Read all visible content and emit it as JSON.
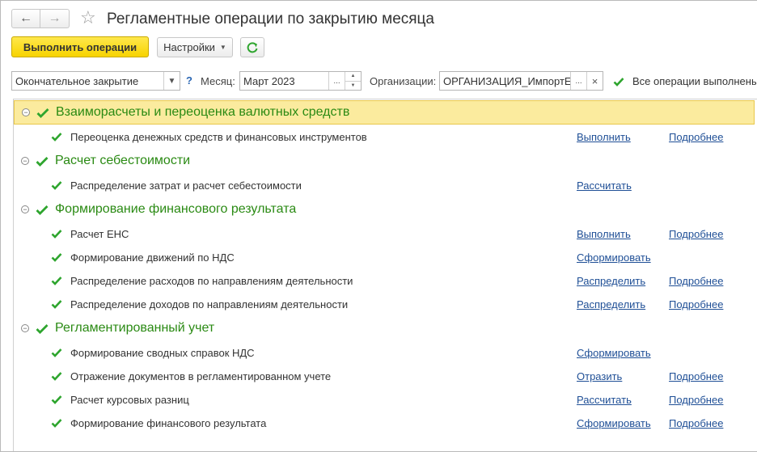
{
  "header": {
    "title": "Регламентные операции по закрытию месяца"
  },
  "toolbar": {
    "run_label": "Выполнить операции",
    "settings_label": "Настройки"
  },
  "filters": {
    "close_type": "Окончательное закрытие",
    "help_mark": "?",
    "month_label": "Месяц:",
    "month_value": "Март 2023",
    "month_select": "...",
    "org_label": "Организации:",
    "org_value": "ОРГАНИЗАЦИЯ_ИмпортЕ",
    "org_select": "...",
    "org_clear": "×",
    "status_text": "Все операции выполнены"
  },
  "groups": [
    {
      "title": "Взаиморасчеты и переоценка валютных средств",
      "items": [
        {
          "title": "Переоценка денежных средств и финансовых инструментов",
          "action": "Выполнить",
          "more": "Подробнее"
        }
      ]
    },
    {
      "title": "Расчет себестоимости",
      "items": [
        {
          "title": "Распределение затрат и расчет себестоимости",
          "action": "Рассчитать",
          "more": ""
        }
      ]
    },
    {
      "title": "Формирование финансового результата",
      "items": [
        {
          "title": "Расчет ЕНС",
          "action": "Выполнить",
          "more": "Подробнее"
        },
        {
          "title": "Формирование движений по НДС",
          "action": "Сформировать",
          "more": ""
        },
        {
          "title": "Распределение расходов по направлениям деятельности",
          "action": "Распределить",
          "more": "Подробнее"
        },
        {
          "title": "Распределение доходов по направлениям деятельности",
          "action": "Распределить",
          "more": "Подробнее"
        }
      ]
    },
    {
      "title": "Регламентированный учет",
      "items": [
        {
          "title": "Формирование сводных справок НДС",
          "action": "Сформировать",
          "more": ""
        },
        {
          "title": "Отражение документов в регламентированном учете",
          "action": "Отразить",
          "more": "Подробнее"
        },
        {
          "title": "Расчет курсовых разниц",
          "action": "Рассчитать",
          "more": "Подробнее"
        },
        {
          "title": "Формирование финансового результата",
          "action": "Сформировать",
          "more": "Подробнее"
        }
      ]
    }
  ],
  "colors": {
    "accent_yellow": "#f7d300",
    "check_green": "#2ea52e",
    "group_green": "#2a8a13",
    "link_blue": "#1f4f96",
    "selected_row": "#fbeb9e"
  }
}
